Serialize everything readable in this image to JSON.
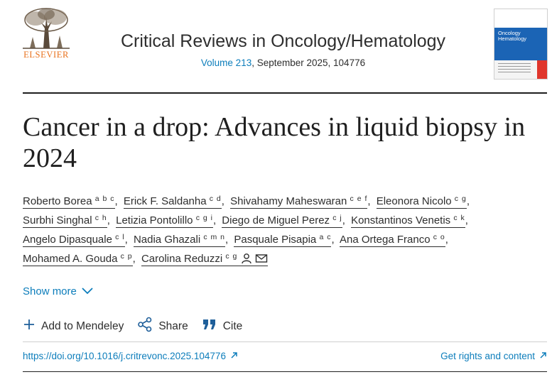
{
  "publisher": {
    "logo_text": "ELSEVIER"
  },
  "journal": {
    "title": "Critical Reviews in Oncology/Hematology",
    "volume_label": "Volume 213",
    "issue_rest": ", September 2025, 104776",
    "cover_title": "Oncology Hematology"
  },
  "article": {
    "title": "Cancer in a drop: Advances in liquid biopsy in 2024"
  },
  "authors": [
    {
      "name": "Roberto Borea",
      "sup": "a b c"
    },
    {
      "name": "Erick F. Saldanha",
      "sup": "c d"
    },
    {
      "name": "Shivahamy Maheswaran",
      "sup": "c e f"
    },
    {
      "name": "Eleonora Nicolo",
      "sup": "c g"
    },
    {
      "name": "Surbhi Singhal",
      "sup": "c h"
    },
    {
      "name": "Letizia Pontolillo",
      "sup": "c g i"
    },
    {
      "name": "Diego de Miguel Perez",
      "sup": "c j"
    },
    {
      "name": "Konstantinos Venetis",
      "sup": "c k"
    },
    {
      "name": "Angelo Dipasquale",
      "sup": "c l"
    },
    {
      "name": "Nadia Ghazali",
      "sup": "c m n"
    },
    {
      "name": "Pasquale Pisapia",
      "sup": "a c"
    },
    {
      "name": "Ana Ortega Franco",
      "sup": "c o"
    },
    {
      "name": "Mohamed A. Gouda",
      "sup": "c p"
    },
    {
      "name": "Carolina Reduzzi",
      "sup": "c g"
    }
  ],
  "show_more": "Show more",
  "actions": {
    "mendeley": "Add to Mendeley",
    "share": "Share",
    "cite": "Cite"
  },
  "links": {
    "doi": "https://doi.org/10.1016/j.critrevonc.2025.104776",
    "rights": "Get rights and content"
  },
  "colors": {
    "link": "#0c7dbb",
    "brand_orange": "#e9711c",
    "text": "#1f1f1f"
  },
  "icons": [
    "elsevier-tree-logo",
    "person-icon",
    "envelope-icon",
    "chevron-down-icon",
    "plus-icon",
    "share-icon",
    "quote-icon",
    "external-arrow-icon"
  ]
}
